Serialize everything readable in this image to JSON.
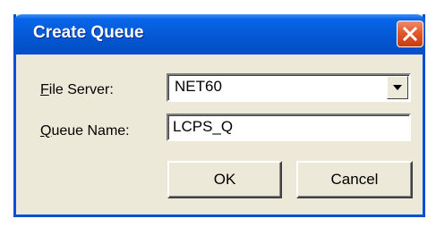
{
  "window": {
    "title": "Create Queue",
    "close_icon": "close-icon"
  },
  "form": {
    "file_server": {
      "label_accel": "F",
      "label_rest": "ile Server:",
      "value": "NET60",
      "dropdown_icon": "chevron-down-icon"
    },
    "queue_name": {
      "label_accel": "Q",
      "label_rest": "ueue Name:",
      "value": "LCPS_Q"
    }
  },
  "buttons": {
    "ok_label": "OK",
    "cancel_label": "Cancel"
  },
  "colors": {
    "titlebar": "#0458d4",
    "dialog_bg": "#ece9d8",
    "close_button": "#e35a2c",
    "border": "#0a4fd6"
  }
}
